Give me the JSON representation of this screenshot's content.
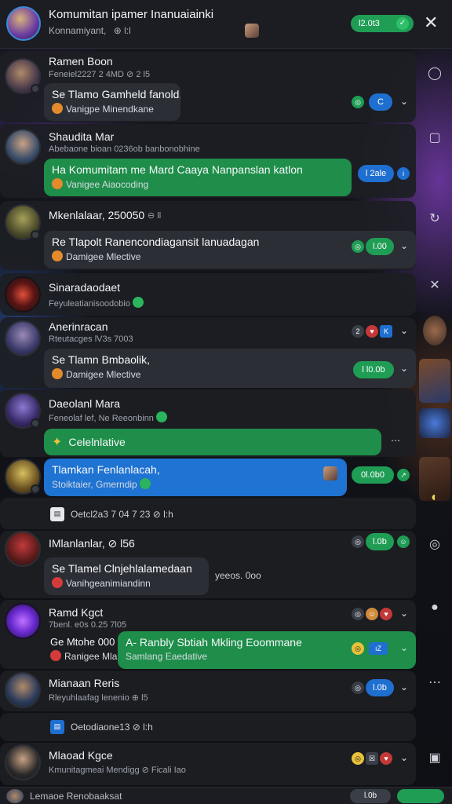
{
  "header": {
    "title": "Komumitan ipamer Inanuaiainki",
    "subtitle": "Konnamiyant,",
    "subtitle_extra": "⊕ l:l",
    "status_pill": "l2.0t3",
    "close_icon": "close-icon"
  },
  "posts": [
    {
      "name": "Ramen Boon",
      "meta": "Feneiel2227 2 4MD ⊘ 2 l5",
      "bubble_title": "Se Tlamo Gamheld fanold,",
      "bubble_sub": "Vanigpe Minendkane",
      "tags": [
        "C"
      ],
      "colors": {
        "bubble": "#2b2e34"
      }
    },
    {
      "name": "Shaudita Mar",
      "meta": "Abebaone bioan 0236ob banbonobhine",
      "bubble_title": "Ha Komumitam me Mard Caaya Nanpanslan katlon",
      "bubble_sub": "Vanigee Aiaocoding",
      "tags": [
        "l 2ale"
      ],
      "colors": {
        "bubble": "#1e8e4a"
      }
    },
    {
      "name": "Mkenlalaar, 250050",
      "meta": "⊖ ll",
      "bubble_title": "Re Tlapolt Ranencondiagansit lanuadagan",
      "bubble_sub": "Damigee Mlective",
      "tags": [
        "l.00"
      ],
      "colors": {
        "bubble": "#2b2e34"
      }
    },
    {
      "name": "Sinaradaodaet",
      "meta": "Feyuleatianisoodobio",
      "bubble_title": "",
      "bubble_sub": "",
      "tags": [],
      "colors": {
        "bubble": "#2b2e34"
      }
    },
    {
      "name": "Anerinracan",
      "meta": "Rteutacges lV3s 7003",
      "bubble_title": "Se Tlamn Bmbaolik,",
      "bubble_sub": "Damigee Mlective",
      "tags": [
        "l l0.0b"
      ],
      "colors": {
        "bubble": "#2b2e34"
      }
    },
    {
      "name": "Daeolanl Mara",
      "meta": "Feneolaf lef, Ne Reeonbinn",
      "bubble_title": "Celelnlative",
      "bubble_sub": "",
      "tags": [],
      "colors": {
        "bubble": "#1e8e4a"
      }
    },
    {
      "name": "",
      "meta": "",
      "bubble_title": "Tlamkan Fenlanlacah,",
      "bubble_sub": "Stoiktaier, Gmerndip",
      "tags": [
        "0l.0b0"
      ],
      "colors": {
        "bubble": "#1f73d2"
      }
    },
    {
      "name": "",
      "meta": "Oetcl2a3 7 04 7 23 ⊘ l:h",
      "bubble_title": "",
      "bubble_sub": "",
      "tags": [],
      "colors": {
        "bubble": "#2b2e34"
      }
    },
    {
      "name": "IMlanlanlar, ⊘ l56",
      "meta": "",
      "bubble_title": "Se Tlamel Clnjehlalamedaan",
      "bubble_sub": "Vanihgeanimiandinn",
      "bubble_extra": "yeeos. 0oo",
      "tags": [
        "l.0b"
      ],
      "colors": {
        "bubble": "#2b2e34"
      }
    },
    {
      "name": "Ramd Kgct",
      "meta": "7benl. e0s 0.25 7l05",
      "bubble_title": "A- Ranbly Sbtiah Mkling Eoommane",
      "bubble_sub": "Samlang Eaedative",
      "reply_title": "Ge Mtohe 000",
      "reply_sub": "Ranigee Mlandlo",
      "tags": [],
      "colors": {
        "bubble": "#1e8e4a"
      }
    },
    {
      "name": "Mianaan Reris",
      "meta": "Rleyuhlaafag lenenio ⊕ l5",
      "bubble_title": "",
      "bubble_sub": "",
      "tags": [
        "l.0b"
      ],
      "colors": {
        "bubble": "#2b2e34"
      }
    },
    {
      "name": "",
      "meta": "Oetodiaone13 ⊘ l:h",
      "bubble_title": "",
      "bubble_sub": "",
      "tags": [],
      "colors": {
        "bubble": "#2b2e34"
      }
    },
    {
      "name": "Mlaoad Kgce",
      "meta": "Kmunitagmeai Mendigg ⊘ Ficali Iao",
      "bubble_title": "",
      "bubble_sub": "",
      "tags": [],
      "colors": {
        "bubble": "#2b2e34"
      }
    }
  ],
  "footer": {
    "text": "Lemaoe Renobaaksat",
    "pill": "l.0b"
  },
  "colors": {
    "accent_green": "#1f9d55",
    "accent_blue": "#1f6fd1",
    "panel": "#1c1e23",
    "background": "#0f1115"
  }
}
